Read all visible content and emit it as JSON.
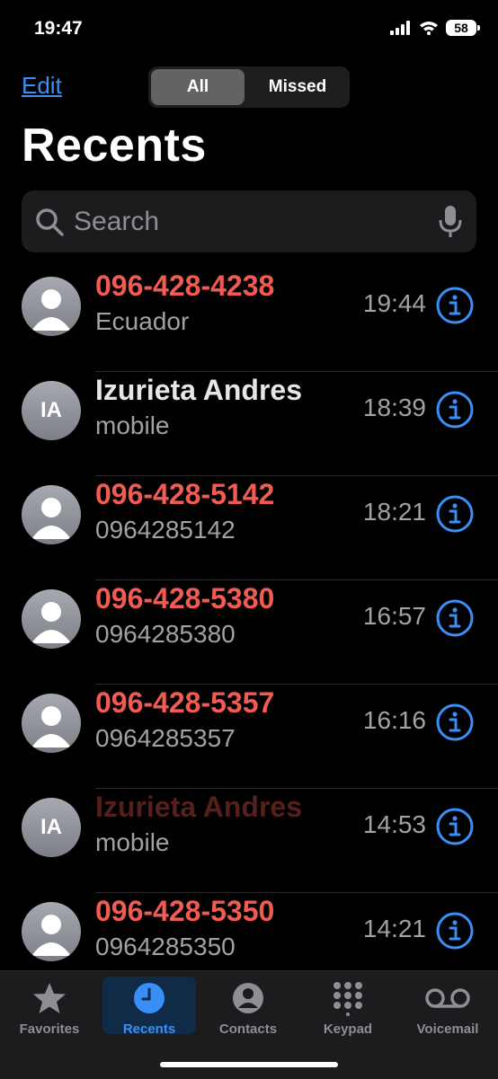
{
  "status": {
    "time": "19:47",
    "battery": "58"
  },
  "header": {
    "edit_label": "Edit",
    "title": "Recents"
  },
  "filter": {
    "all_label": "All",
    "missed_label": "Missed",
    "selected": "All"
  },
  "search": {
    "placeholder": "Search"
  },
  "calls": [
    {
      "name": "096-428-4238",
      "detail": "Ecuador",
      "time": "19:44",
      "missed": true,
      "initials": ""
    },
    {
      "name": "Izurieta Andres",
      "detail": "mobile",
      "time": "18:39",
      "missed": false,
      "initials": "IA"
    },
    {
      "name": "096-428-5142",
      "detail": "0964285142",
      "time": "18:21",
      "missed": true,
      "initials": ""
    },
    {
      "name": "096-428-5380",
      "detail": "0964285380",
      "time": "16:57",
      "missed": true,
      "initials": ""
    },
    {
      "name": "096-428-5357",
      "detail": "0964285357",
      "time": "16:16",
      "missed": true,
      "initials": ""
    },
    {
      "name": "Izurieta Andres",
      "detail": "mobile",
      "time": "14:53",
      "missed": true,
      "initials": "IA"
    },
    {
      "name": "096-428-5350",
      "detail": "0964285350",
      "time": "14:21",
      "missed": true,
      "initials": ""
    }
  ],
  "tabs": [
    {
      "label": "Favorites",
      "icon": "star-icon"
    },
    {
      "label": "Recents",
      "icon": "clock-icon",
      "active": true
    },
    {
      "label": "Contacts",
      "icon": "person-circle-icon"
    },
    {
      "label": "Keypad",
      "icon": "keypad-icon"
    },
    {
      "label": "Voicemail",
      "icon": "voicemail-icon"
    }
  ],
  "colors": {
    "accent": "#3a8ff6",
    "missed": "#f25a52",
    "secondary_text": "#a1a1a6"
  }
}
